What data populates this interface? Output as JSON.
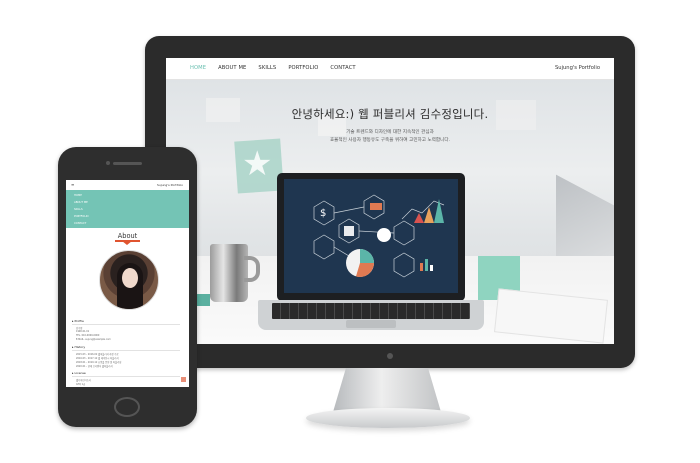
{
  "desktop": {
    "nav": {
      "items": [
        "HOME",
        "ABOUT ME",
        "SKILLS",
        "PORTFOLIO",
        "CONTACT"
      ],
      "active": "HOME",
      "brand": "Sujung's Portfolio"
    },
    "hero": {
      "title": "안녕하세요:) 웹 퍼블리셔 김수정입니다.",
      "line1": "기술 트렌드와 디자인에 대한 지속적인 관심과",
      "line2": "효율적인 사용자 행동유도 구축을 위하여 고민하고 노력합니다."
    }
  },
  "mobile": {
    "top": {
      "menu_icon": "≡",
      "brand": "Sujung's Portfolio"
    },
    "nav": {
      "items": [
        "HOME",
        "ABOUT ME",
        "SKILLS",
        "PORTFOLIO",
        "CONTACT"
      ]
    },
    "about": {
      "title": "About"
    },
    "sections": [
      {
        "title": "Profile",
        "lines": [
          "김수정",
          "1990.01.01",
          "TEL. 010-0000-0000",
          "E-MAIL. sujung@example.com"
        ]
      },
      {
        "title": "History",
        "lines": [
          "2015.03 - 2016.02 웹퍼블리셔 과정 수료",
          "2016.03 - 2017.12 웹 에이전시 퍼블리셔",
          "2018.01 - 2019.12 쇼핑몰 운영 및 퍼블리싱",
          "2020.01 - 현재 프리랜서 웹퍼블리셔"
        ]
      },
      {
        "title": "License",
        "lines": [
          "웹디자인기능사",
          "GTQ 1급"
        ]
      }
    ]
  },
  "colors": {
    "accent": "#74c4b5",
    "nav_active": "#6cc0b2",
    "about_marker": "#e0542f",
    "frame": "#2b2b2b"
  },
  "icons": {
    "menu": "hamburger-menu-icon"
  }
}
